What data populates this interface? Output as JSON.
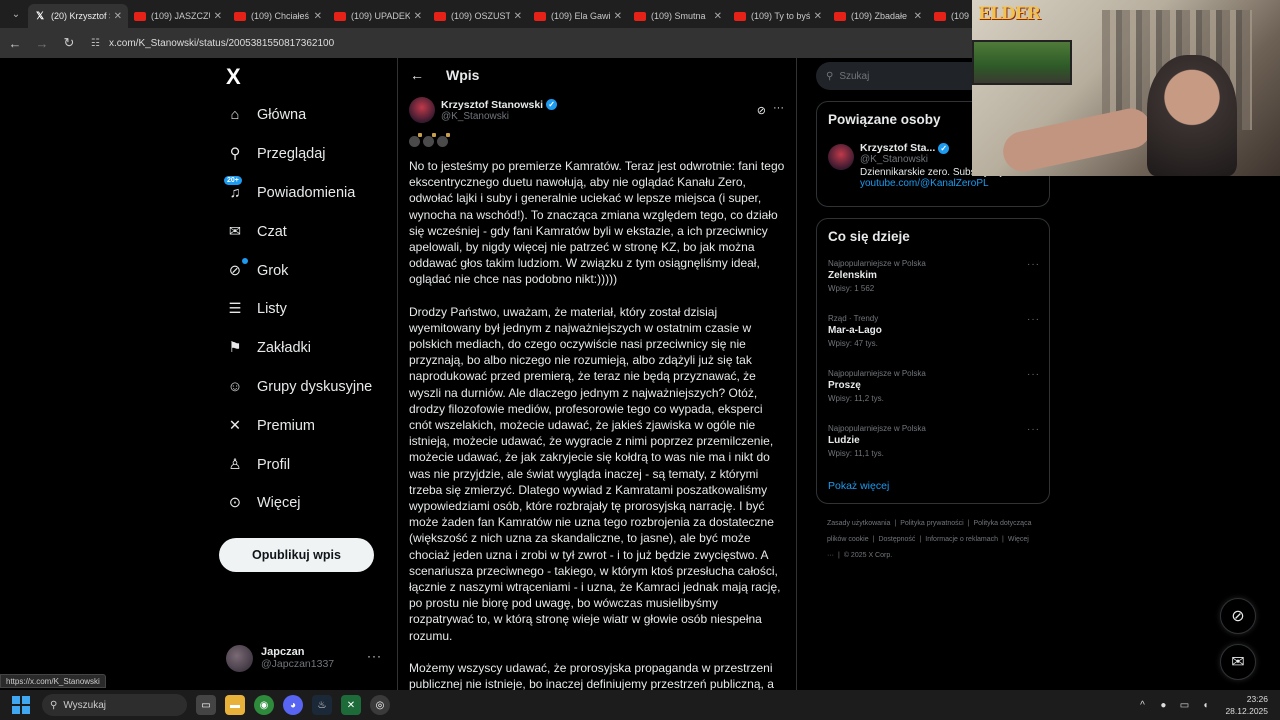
{
  "browser": {
    "tabs": [
      {
        "label": "(20) Krzysztof S",
        "active": true
      },
      {
        "label": "(109) JASZCZU"
      },
      {
        "label": "(109) Chciałeś"
      },
      {
        "label": "(109) UPADEK"
      },
      {
        "label": "(109) OSZUST"
      },
      {
        "label": "(109) Ela Gawi"
      },
      {
        "label": "(109) Smutna"
      },
      {
        "label": "(109) Ty to byś"
      },
      {
        "label": "(109) Zbadałe"
      },
      {
        "label": "(109"
      }
    ],
    "url": "x.com/K_Stanowski/status/2005381550817362100",
    "hover_url": "https://x.com/K_Stanowski"
  },
  "nav": {
    "logo": "X",
    "items": [
      {
        "label": "Główna",
        "icon": "home-icon"
      },
      {
        "label": "Przeglądaj",
        "icon": "search-icon"
      },
      {
        "label": "Powiadomienia",
        "icon": "bell-icon",
        "badge": "20+"
      },
      {
        "label": "Czat",
        "icon": "mail-icon"
      },
      {
        "label": "Grok",
        "icon": "grok-icon"
      },
      {
        "label": "Listy",
        "icon": "list-icon"
      },
      {
        "label": "Zakładki",
        "icon": "bookmark-icon"
      },
      {
        "label": "Grupy dyskusyjne",
        "icon": "people-icon"
      },
      {
        "label": "Premium",
        "icon": "x-premium-icon"
      },
      {
        "label": "Profil",
        "icon": "person-icon"
      },
      {
        "label": "Więcej",
        "icon": "more-circle-icon"
      }
    ],
    "publish": "Opublikuj wpis",
    "account": {
      "name": "Japczan",
      "handle": "@Japczan1337"
    }
  },
  "post": {
    "header": "Wpis",
    "author": {
      "name": "Krzysztof Stanowski",
      "handle": "@K_Stanowski"
    },
    "paragraphs": [
      "No to jesteśmy po premierze Kamratów. Teraz jest odwrotnie: fani tego ekscentrycznego duetu nawołują, aby nie oglądać Kanału Zero, odwołać lajki i suby i generalnie uciekać w lepsze miejsca (i super, wynocha na wschód!). To znacząca zmiana względem tego, co działo się wcześniej - gdy fani Kamratów byli w ekstazie, a ich przeciwnicy apelowali, by nigdy więcej nie patrzeć w stronę KZ, bo jak można oddawać głos takim ludziom. W związku z tym osiągnęliśmy ideał, oglądać nie chce nas podobno nikt:)))))",
      "Drodzy Państwo, uważam, że materiał, który został dzisiaj wyemitowany był jednym z najważniejszych w ostatnim czasie w polskich mediach, do czego oczywiście nasi przeciwnicy się nie przyznają, bo albo niczego nie rozumieją, albo zdążyli już się tak naprodukować przed premierą, że teraz nie będą przyznawać, że wyszli na durniów. Ale dlaczego jednym z najważniejszych? Otóż, drodzy filozofowie mediów, profesorowie tego co wypada, eksperci cnót wszelakich, możecie udawać, że jakieś zjawiska w ogóle nie istnieją, możecie udawać, że wygracie z nimi poprzez przemilczenie, możecie udawać, że jak zakryjecie się kołdrą to was nie ma i nikt do was nie przyjdzie, ale świat wygląda inaczej - są tematy, z którymi trzeba się zmierzyć. Dlatego wywiad z Kamratami poszatkowaliśmy wypowiedziami osób, które rozbrajały tę prorosyjską narrację. I być może żaden fan Kamratów nie uzna tego rozbrojenia za dostateczne (większość z nich uzna za skandaliczne, to jasne), ale być może chociaż jeden uzna i zrobi w tył zwrot - i to już będzie zwycięstwo. A scenariusza przeciwnego - takiego, w którym ktoś przesłucha całości, łącznie z naszymi wtrąceniami - i uzna, że Kamraci jednak mają rację, po prostu nie biorę pod uwagę, bo wówczas musielibyśmy rozpatrywać to, w którą stronę wieje wiatr w głowie osób niespełna rozumu.",
      "Możemy wszyscy udawać, że prorosyjska propaganda w przestrzeni publicznej nie istnieje, bo inaczej definiujemy przestrzeń publiczną, a możemy ją wskazywać palcem i detonować w sposób kontrolowany, przy wsparciu fachowców. Niektórzy niech się dalej zachwycają"
    ]
  },
  "right": {
    "search_placeholder": "Szukaj",
    "related": {
      "title": "Powiązane osoby",
      "name": "Krzysztof Sta...",
      "handle": "@K_Stanowski",
      "bio": "Dziennikarskie zero. Subskrybuj:",
      "link": "youtube.com/@KanalZeroPL"
    },
    "trends": {
      "title": "Co się dzieje",
      "items": [
        {
          "context": "Najpopularniejsze w Polska",
          "name": "Zelenskim",
          "count": "Wpisy: 1 562"
        },
        {
          "context": "Rząd · Trendy",
          "name": "Mar-a-Lago",
          "count": "Wpisy: 47 tys."
        },
        {
          "context": "Najpopularniejsze w Polska",
          "name": "Proszę",
          "count": "Wpisy: 11,2 tys."
        },
        {
          "context": "Najpopularniejsze w Polska",
          "name": "Ludzie",
          "count": "Wpisy: 11,1 tys."
        }
      ],
      "show_more": "Pokaż więcej"
    },
    "footer": [
      "Zasady użytkowania",
      "Polityka prywatności",
      "Polityka dotycząca plików cookie",
      "Dostępność",
      "Informacje o reklamach",
      "Więcej ···",
      "© 2025 X Corp."
    ]
  },
  "overlay": {
    "logo": "ELDER"
  },
  "taskbar": {
    "search": "Wyszukaj",
    "time": "23:26",
    "date": "28.12.2025"
  }
}
